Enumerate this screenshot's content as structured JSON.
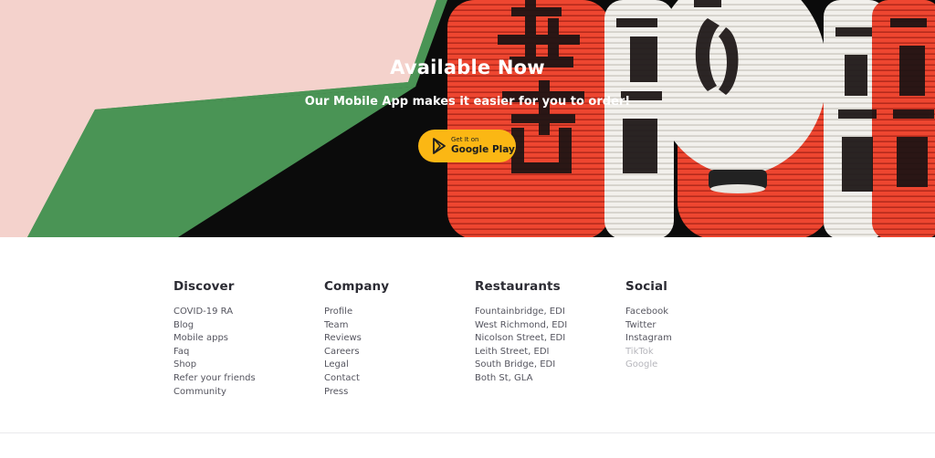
{
  "hero": {
    "title": "Available Now",
    "subtitle": "Our Mobile App makes it easier for you to order!",
    "store_button": {
      "small_label": "Get It on",
      "big_label": "Google Play",
      "icon": "play-store-icon"
    }
  },
  "footer": {
    "columns": [
      {
        "title": "Discover",
        "items": [
          "COVID-19 RA",
          "Blog",
          "Mobile apps",
          "Faq",
          "Shop",
          "Refer your friends",
          "Community"
        ]
      },
      {
        "title": "Company",
        "items": [
          "Profile",
          "Team",
          "Reviews",
          "Careers",
          "Legal",
          "Contact",
          "Press"
        ]
      },
      {
        "title": "Restaurants",
        "items": [
          "Fountainbridge, EDI",
          "West Richmond, EDI",
          "Nicolson Street, EDI",
          "Leith Street, EDI",
          "South Bridge, EDI",
          "Both St, GLA"
        ]
      },
      {
        "title": "Social",
        "items": [
          "Facebook",
          "Twitter",
          "Instagram",
          "TikTok",
          "Google"
        ]
      }
    ]
  },
  "colors": {
    "pink_panel": "#f4d2cc",
    "green_panel": "#4a9455",
    "lantern_red": "#ee4630",
    "lantern_white": "#f2f0ec",
    "button_yellow": "#fbb714",
    "text_dark": "#2b2b33",
    "text_muted": "#b6b6bc"
  }
}
